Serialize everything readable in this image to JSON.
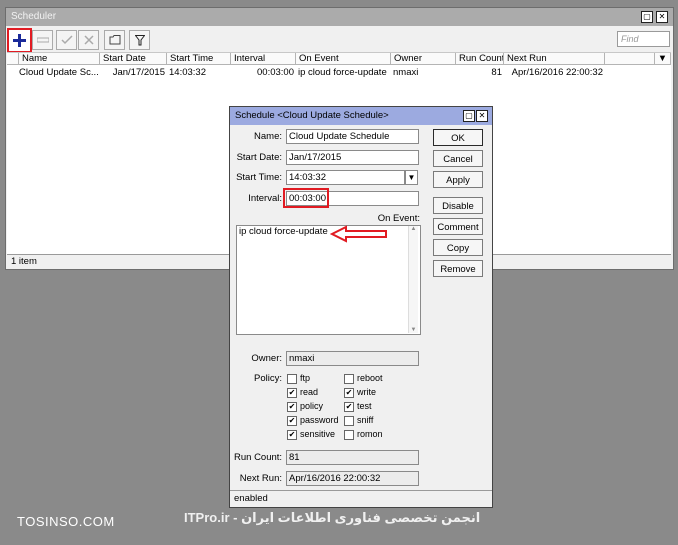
{
  "scheduler": {
    "title": "Scheduler",
    "find_placeholder": "Find",
    "columns": [
      "Name",
      "Start Date",
      "Start Time",
      "Interval",
      "On Event",
      "Owner",
      "Run Count",
      "Next Run"
    ],
    "rows": [
      {
        "name": "Cloud Update Sc...",
        "start_date": "Jan/17/2015",
        "start_time": "14:03:32",
        "interval": "00:03:00",
        "on_event": "ip cloud force-update",
        "owner": "nmaxi",
        "run_count": "81",
        "next_run": "Apr/16/2016 22:00:32"
      }
    ],
    "status": "1 item"
  },
  "dialog": {
    "title": "Schedule <Cloud Update Schedule>",
    "fields": {
      "name_label": "Name:",
      "name_value": "Cloud Update Schedule",
      "start_date_label": "Start Date:",
      "start_date_value": "Jan/17/2015",
      "start_time_label": "Start Time:",
      "start_time_value": "14:03:32",
      "interval_label": "Interval:",
      "interval_value": "00:03:00",
      "on_event_label": "On Event:",
      "on_event_value": "ip cloud force-update",
      "owner_label": "Owner:",
      "owner_value": "nmaxi",
      "policy_label": "Policy:",
      "run_count_label": "Run Count:",
      "run_count_value": "81",
      "next_run_label": "Next Run:",
      "next_run_value": "Apr/16/2016 22:00:32"
    },
    "policies": [
      {
        "label": "ftp",
        "checked": false
      },
      {
        "label": "reboot",
        "checked": false
      },
      {
        "label": "read",
        "checked": true
      },
      {
        "label": "write",
        "checked": true
      },
      {
        "label": "policy",
        "checked": true
      },
      {
        "label": "test",
        "checked": true
      },
      {
        "label": "password",
        "checked": true
      },
      {
        "label": "sniff",
        "checked": false
      },
      {
        "label": "sensitive",
        "checked": true
      },
      {
        "label": "romon",
        "checked": false
      }
    ],
    "buttons": [
      "OK",
      "Cancel",
      "Apply",
      "Disable",
      "Comment",
      "Copy",
      "Remove"
    ],
    "status": "enabled"
  },
  "watermark": {
    "left": "TOSINSO.COM",
    "right": "ITPro.ir - انجمن تخصصی فناوری اطلاعات ایران"
  },
  "colors": {
    "dialog_title_bg": "#9caae0",
    "highlight": "#e11b22",
    "add_icon": "#1a2a9a"
  }
}
